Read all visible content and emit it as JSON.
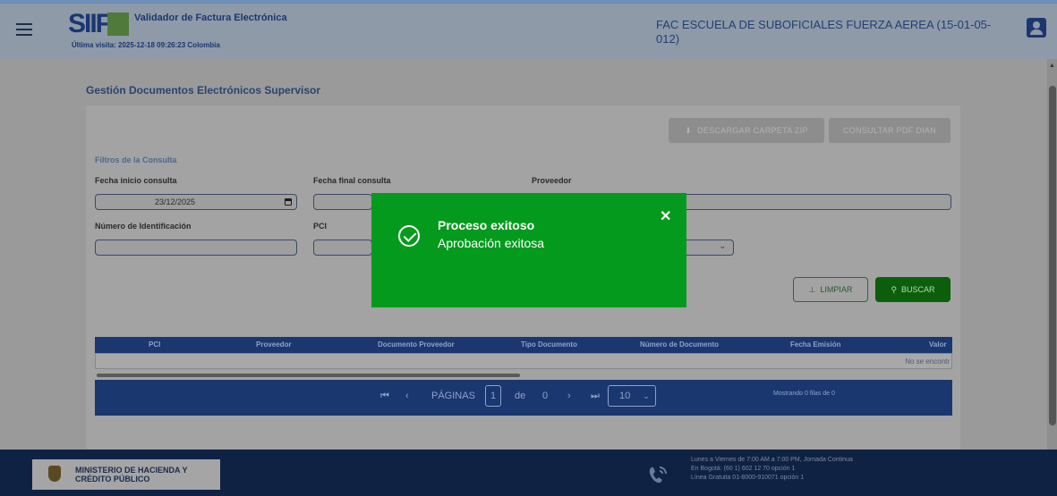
{
  "header": {
    "logo_text": "SIIF",
    "app_title": "Validador de Factura Electrónica",
    "last_visit": "Última visita: 2025-12-18 09:26:23 Colombia",
    "entity": "FAC ESCUELA DE SUBOFICIALES FUERZA AEREA (15-01-05-012)"
  },
  "page": {
    "title": "Gestión Documentos Electrónicos Supervisor"
  },
  "actions": {
    "download_zip": "DESCARGAR CARPETA ZIP",
    "consult_pdf": "CONSULTAR PDF DIAN"
  },
  "filters": {
    "section_title": "Filtros de la Consulta",
    "start_date_label": "Fecha inicio consulta",
    "start_date_value": "23/12/2025",
    "end_date_label": "Fecha final consulta",
    "provider_label": "Proveedor",
    "id_number_label": "Número de Identificación",
    "pci_label": "PCI",
    "clear_label": "LIMPIAR",
    "search_label": "BUSCAR"
  },
  "table": {
    "columns": [
      "PCI",
      "Proveedor",
      "Documento Proveedor",
      "Tipo Documento",
      "Número de Documento",
      "Fecha Emisión",
      "Valor"
    ],
    "empty_text": "No se encontr"
  },
  "pager": {
    "pages_label": "PÁGINAS",
    "current_page": "1",
    "of_label": "de",
    "total_pages": "0",
    "page_size": "10",
    "showing": "Mostrando 0 filas de 0"
  },
  "footer": {
    "ministry_line1": "MINISTERIO DE HACIENDA Y",
    "ministry_line2": "CRÉDITO PÚBLICO",
    "hours": "Lunes a Viernes de 7:00 AM a 7:00 PM, Jornada Continua",
    "bogota": "En Bogotá: (60 1) 602 12 70 opción 1",
    "toll_free": "Línea Gratuita 01-8000-910071 opción 1"
  },
  "toast": {
    "title": "Proceso exitoso",
    "message": "Aprobación exitosa",
    "close_glyph": "✕",
    "color": "#049a1d"
  }
}
